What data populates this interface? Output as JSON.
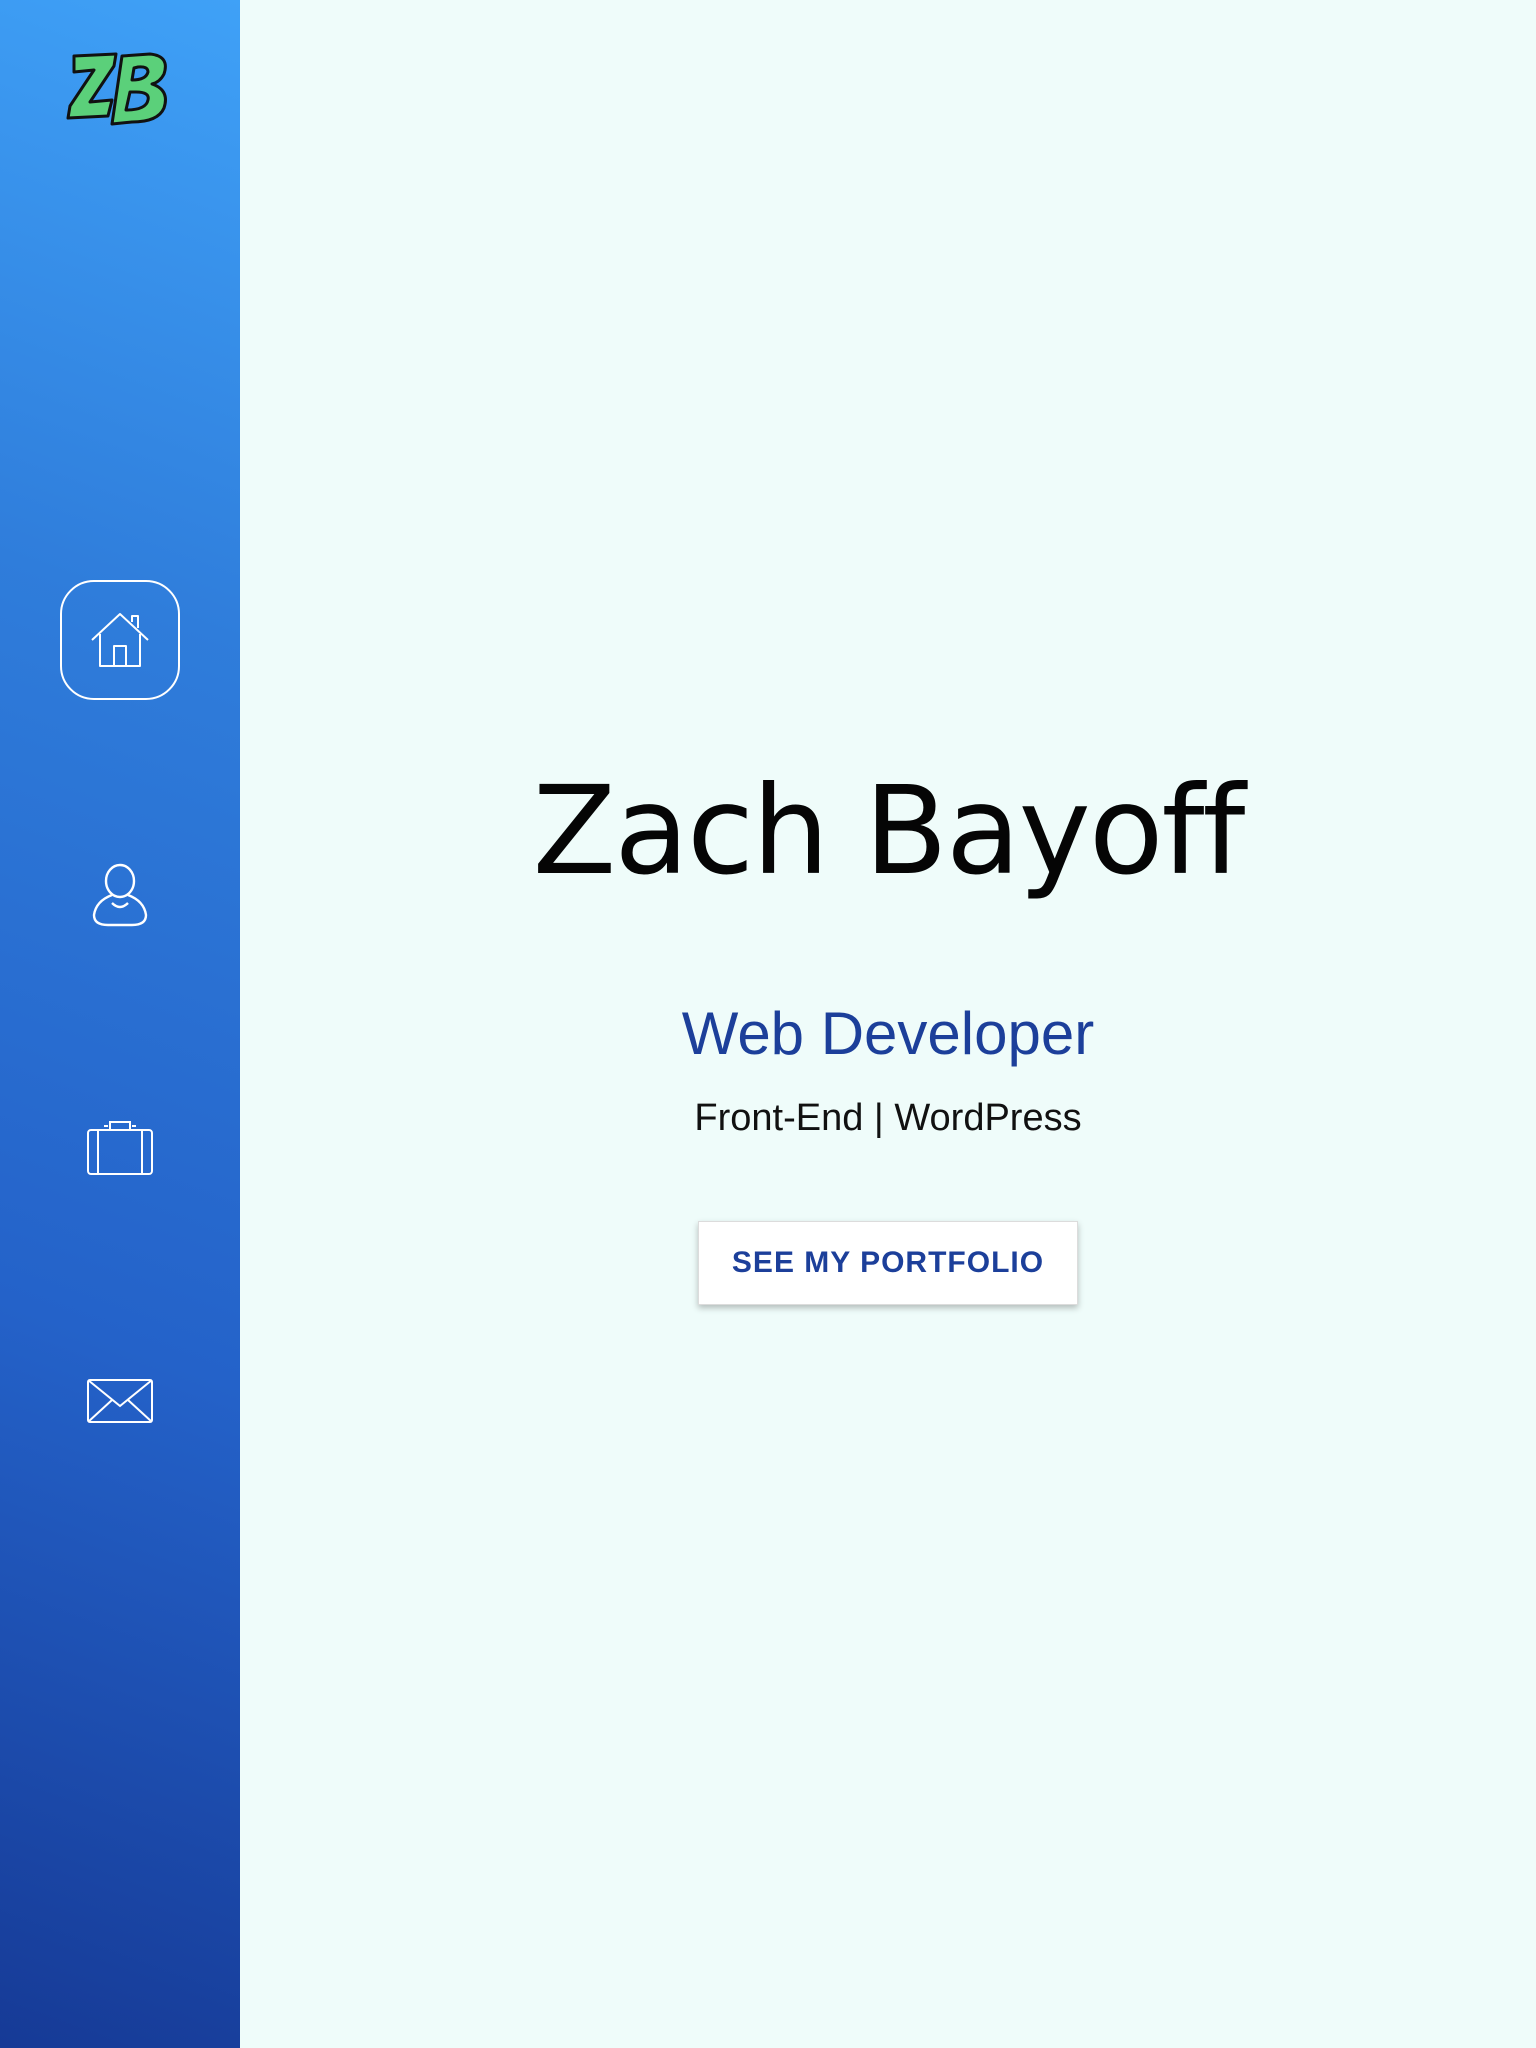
{
  "sidebar": {
    "logo_text": "ZB",
    "items": [
      {
        "id": "home",
        "icon": "home-icon",
        "active": true
      },
      {
        "id": "about",
        "icon": "user-icon",
        "active": false
      },
      {
        "id": "portfolio",
        "icon": "briefcase-icon",
        "active": false
      },
      {
        "id": "contact",
        "icon": "envelope-icon",
        "active": false
      }
    ]
  },
  "hero": {
    "name": "Zach Bayoff",
    "role": "Web Developer",
    "skills": "Front-End | WordPress",
    "cta_label": "SEE MY PORTFOLIO"
  },
  "colors": {
    "background": "#effcfa",
    "sidebar_top": "#3fa1f7",
    "sidebar_bottom": "#163a96",
    "accent": "#1c3f9a",
    "logo_green": "#5bd07a"
  }
}
